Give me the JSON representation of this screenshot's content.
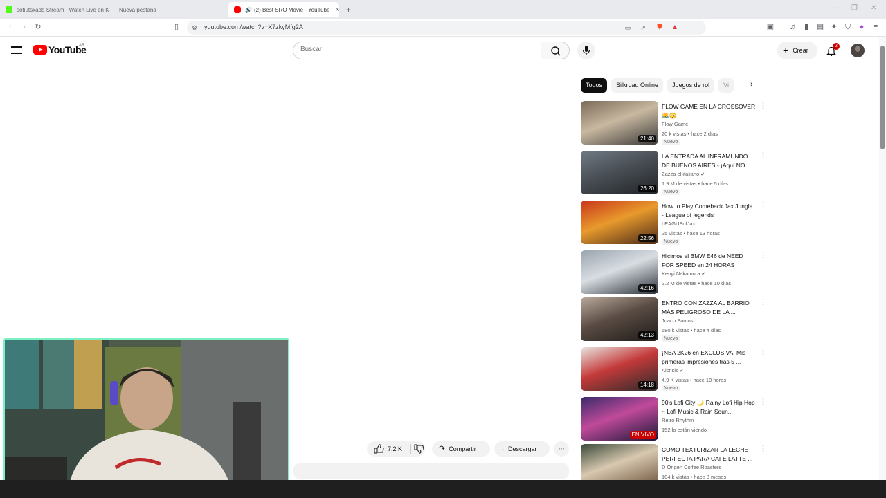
{
  "browser": {
    "tabs": [
      {
        "title": "sofiutskada Stream - Watch Live on K",
        "favicon_color": "#53fc18",
        "active": false
      },
      {
        "title": "Nueva pestaña",
        "favicon_color": "",
        "active": false
      },
      {
        "title": "(2) Best SRO Movie - YouTube",
        "favicon_color": "#ff0000",
        "active": true,
        "audio": "🔊"
      }
    ],
    "new_tab": "+",
    "url": "youtube.com/watch?v=X7zkyMfg2A"
  },
  "youtube": {
    "logo_text": "YouTube",
    "region": "AR",
    "search_placeholder": "Buscar",
    "create_label": "Crear",
    "notification_count": "2"
  },
  "chips": [
    "Todos",
    "Silkroad Online",
    "Juegos de rol",
    "Vi"
  ],
  "recommendations": [
    {
      "title": "FLOW GAME EN LA CROSSOVER 😹😳",
      "channel": "Flow Game",
      "meta": "20 k vistas • hace 2 días",
      "duration": "21:40",
      "badge": "Nuevo",
      "thumb_colors": [
        "#7a6a58",
        "#c8b8a0",
        "#3d3b39"
      ]
    },
    {
      "title": "LA ENTRADA AL INFRAMUNDO DE BUENOS AIRES - ¡Aquí NO ...",
      "channel": "Zazza el italiano",
      "verified": true,
      "meta": "1.9 M de vistas • hace 5 días",
      "duration": "26:20",
      "badge": "Nuevo",
      "thumb_colors": [
        "#707a84",
        "#4a4f56",
        "#202427"
      ]
    },
    {
      "title": "How to Play Comeback Jax Jungle - League of legends",
      "channel": "LEAGUEofJax",
      "meta": "25 vistas • hace 13 horas",
      "duration": "22:56",
      "badge": "Nuevo",
      "thumb_colors": [
        "#c8361a",
        "#e89a2c",
        "#4a2a18"
      ]
    },
    {
      "title": "Hicimos el BMW E46 de NEED FOR SPEED en 24 HORAS",
      "channel": "Kenyi Nakamura",
      "verified": true,
      "meta": "2.2 M de vistas • hace 10 días",
      "duration": "42:16",
      "badge": "",
      "thumb_colors": [
        "#9aa4ae",
        "#d8dde2",
        "#2a3038"
      ]
    },
    {
      "title": "ENTRO CON ZAZZA AL BARRIO MÁS PELIGROSO DE LA ...",
      "channel": "Joaco Santos",
      "meta": "680 k vistas • hace 4 días",
      "duration": "42:13",
      "badge": "Nuevo",
      "thumb_colors": [
        "#b8a89a",
        "#5a4c44",
        "#1e1a18"
      ]
    },
    {
      "title": "¡NBA 2K26 en EXCLUSIVA! Mis primeras impresiones tras 5 ...",
      "channel": "Alcrisis",
      "verified": true,
      "meta": "4.9 K vistas • hace 10 horas",
      "duration": "14:18",
      "badge": "Nuevo",
      "thumb_colors": [
        "#e8e4e0",
        "#c43a3a",
        "#2a2a2a"
      ]
    },
    {
      "title": "90's Lofi City 🌙 Rainy Lofi Hip Hop ~ Lofi Music & Rain Soun...",
      "channel": "Retro Rhythm",
      "meta": "152 lo están viendo",
      "live": "EN VIVO",
      "badge": "",
      "thumb_colors": [
        "#3a2a6a",
        "#c04a9a",
        "#1a1838"
      ]
    },
    {
      "title": "COMO TEXTURIZAR LA LECHE PERFECTA PARA CAFE LATTE ...",
      "channel": "D Origen Coffee Roasters",
      "meta": "104 k vistas • hace 3 meses",
      "duration": "",
      "badge": "",
      "thumb_colors": [
        "#3a4a38",
        "#d8c8b0",
        "#6a5038"
      ]
    }
  ],
  "actions": {
    "likes": "7.2 K",
    "share": "Compartir",
    "download": "Descargar",
    "more": "···"
  },
  "colors": {
    "brand_red": "#ff0000",
    "webcam_border": "#7df0c4"
  }
}
